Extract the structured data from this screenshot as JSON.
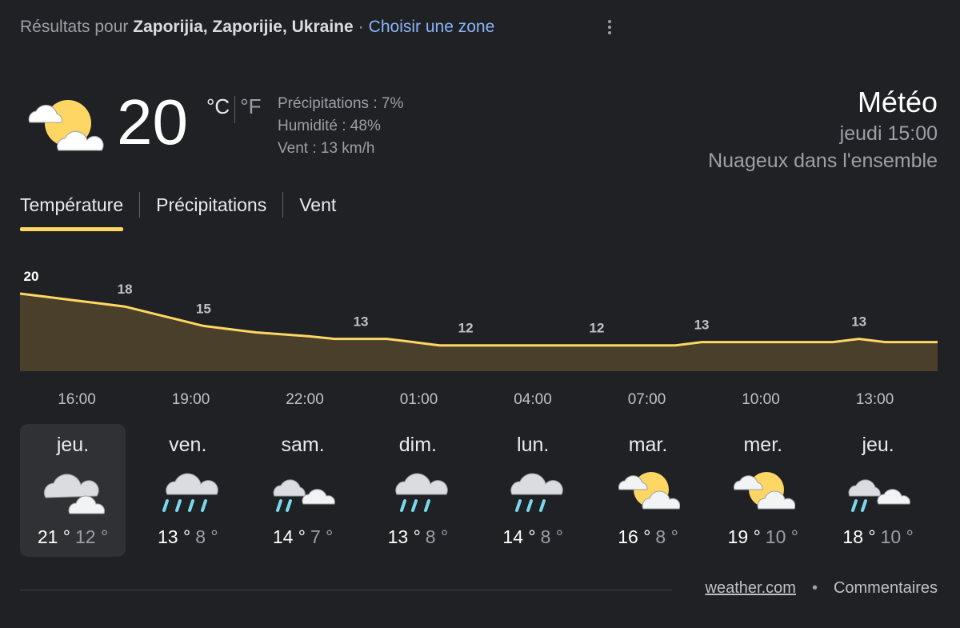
{
  "header": {
    "prefix": "Résultats pour",
    "location": "Zaporijia, Zaporijie, Ukraine",
    "separator": "·",
    "change_zone": "Choisir une zone",
    "more_icon": "more-vert-icon"
  },
  "current": {
    "icon": "partly-cloudy-icon",
    "temperature": "20",
    "unit_c": "°C",
    "unit_f": "°F",
    "precipitation": "Précipitations : 7%",
    "humidity": "Humidité : 48%",
    "wind": "Vent : 13 km/h"
  },
  "summary": {
    "title": "Météo",
    "time": "jeudi 15:00",
    "condition": "Nuageux dans l'ensemble"
  },
  "tabs": [
    {
      "label": "Température",
      "active": true
    },
    {
      "label": "Précipitations",
      "active": false
    },
    {
      "label": "Vent",
      "active": false
    }
  ],
  "chart_data": {
    "type": "area",
    "series": [
      {
        "values": [
          20,
          19.5,
          19,
          18.5,
          18,
          17,
          16,
          15,
          14.5,
          14,
          13.7,
          13.4,
          13,
          13,
          13,
          12.5,
          12,
          12,
          12,
          12,
          12,
          12,
          12,
          12,
          12,
          12,
          12.5,
          12.5,
          12.5,
          12.5,
          12.5,
          12.5,
          13,
          12.5,
          12.5,
          12.5
        ]
      }
    ],
    "labels": [
      {
        "text": "20",
        "index": 0,
        "bold": true
      },
      {
        "text": "18",
        "index": 4
      },
      {
        "text": "15",
        "index": 7
      },
      {
        "text": "13",
        "index": 13
      },
      {
        "text": "12",
        "index": 17
      },
      {
        "text": "12",
        "index": 22
      },
      {
        "text": "13",
        "index": 26
      },
      {
        "text": "13",
        "index": 32
      }
    ],
    "x_ticks": [
      "16:00",
      "19:00",
      "22:00",
      "01:00",
      "04:00",
      "07:00",
      "10:00",
      "13:00"
    ],
    "colors": {
      "line": "#fdd663",
      "fill": "#4a3f2a"
    }
  },
  "days": [
    {
      "name": "jeu.",
      "icon": "cloudy-icon",
      "hi": "21 °",
      "lo": "12 °",
      "selected": true
    },
    {
      "name": "ven.",
      "icon": "rain-icon",
      "hi": "13 °",
      "lo": "8 °"
    },
    {
      "name": "sam.",
      "icon": "scattered-showers-icon",
      "hi": "14 °",
      "lo": "7 °"
    },
    {
      "name": "dim.",
      "icon": "light-rain-icon",
      "hi": "13 °",
      "lo": "8 °"
    },
    {
      "name": "lun.",
      "icon": "light-rain-icon",
      "hi": "14 °",
      "lo": "8 °"
    },
    {
      "name": "mar.",
      "icon": "partly-cloudy-icon",
      "hi": "16 °",
      "lo": "8 °"
    },
    {
      "name": "mer.",
      "icon": "partly-cloudy-icon",
      "hi": "19 °",
      "lo": "10 °"
    },
    {
      "name": "jeu.",
      "icon": "scattered-showers-icon",
      "hi": "18 °",
      "lo": "10 °"
    }
  ],
  "footer": {
    "source": "weather.com",
    "bullet": "•",
    "feedback": "Commentaires"
  }
}
